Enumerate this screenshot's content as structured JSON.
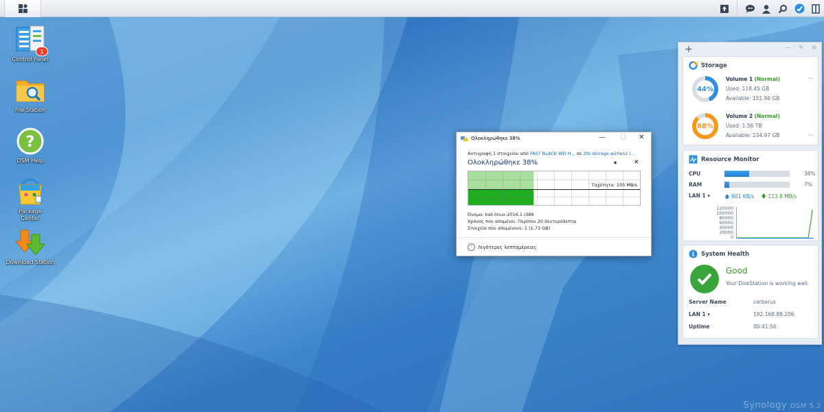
{
  "taskbar": {
    "main_menu_icon": "grid-icon",
    "right_icons": [
      "upload-queue-icon",
      "chat-icon",
      "user-icon",
      "search-icon",
      "widgets-toggle-icon",
      "show-desktop-icon"
    ]
  },
  "desktop_icons": [
    {
      "label": "Control Panel",
      "icon": "control-panel-icon",
      "badge": "1"
    },
    {
      "label": "File Station",
      "icon": "folder-search-icon"
    },
    {
      "label": "DSM Help",
      "icon": "help-icon"
    },
    {
      "label": "Package\nCenter",
      "icon": "shopping-bag-icon"
    },
    {
      "label": "Download Station",
      "icon": "download-arrows-icon"
    }
  ],
  "dialog": {
    "title": "Ολοκληρώθηκε 38%",
    "copy_prefix": "Αντιγραφή 1 στοιχείου από ",
    "source": "FAST BLACK WD H...",
    "to_word": " σε ",
    "destination": "2tb storage w20enz (...",
    "heading": "Ολοκληρώθηκε 38%",
    "progress": 0.38,
    "speed": "Ταχύτητα: 105 MB/s",
    "name_line": "Όνομα:  kali-linux-2016.1-i386",
    "time_line": "Χρόνος που απομένει: Περίπου 20 δευτερόλεπτα",
    "items_line": "Στοιχεία που απομένουν: 1 (1,73 GB)",
    "less_details": "Λιγότερες λεπτομέρειες"
  },
  "widgets": {
    "storage": {
      "title": "Storage",
      "volumes": [
        {
          "name": "Volume 1",
          "status": "Normal",
          "used": "Used: 118.45 GB",
          "available": "Available: 151.96 GB",
          "percent_label": "44%",
          "percent": 44,
          "color": "#2f8ee0"
        },
        {
          "name": "Volume 2",
          "status": "Normal",
          "used": "Used: 1.56 TB",
          "available": "Available: 234.97 GB",
          "percent_label": "88%",
          "percent": 88,
          "color": "#f39a1e"
        }
      ]
    },
    "resource_monitor": {
      "title": "Resource Monitor",
      "cpu_label": "CPU",
      "cpu_value": 38,
      "cpu_pct": "38%",
      "ram_label": "RAM",
      "ram_value": 7,
      "ram_pct": "7%",
      "lan_label": "LAN 1 ▾",
      "upload": "601 KB/s",
      "download": "113.8 MB/s",
      "chart_ticks": [
        "120000",
        "100000",
        "80000",
        "60000",
        "40000",
        "20000",
        "0"
      ]
    },
    "system_health": {
      "title": "System Health",
      "status": "Good",
      "message": "Your DiskStation is working well.",
      "server_name_label": "Server Name",
      "server_name": "cerberus",
      "lan_label": "LAN 1 ▾",
      "lan_ip": "192.168.88.206",
      "uptime_label": "Uptime",
      "uptime": "00:41:56"
    }
  },
  "watermark": {
    "brand": "Synology",
    "product": "DSM 5.2"
  }
}
